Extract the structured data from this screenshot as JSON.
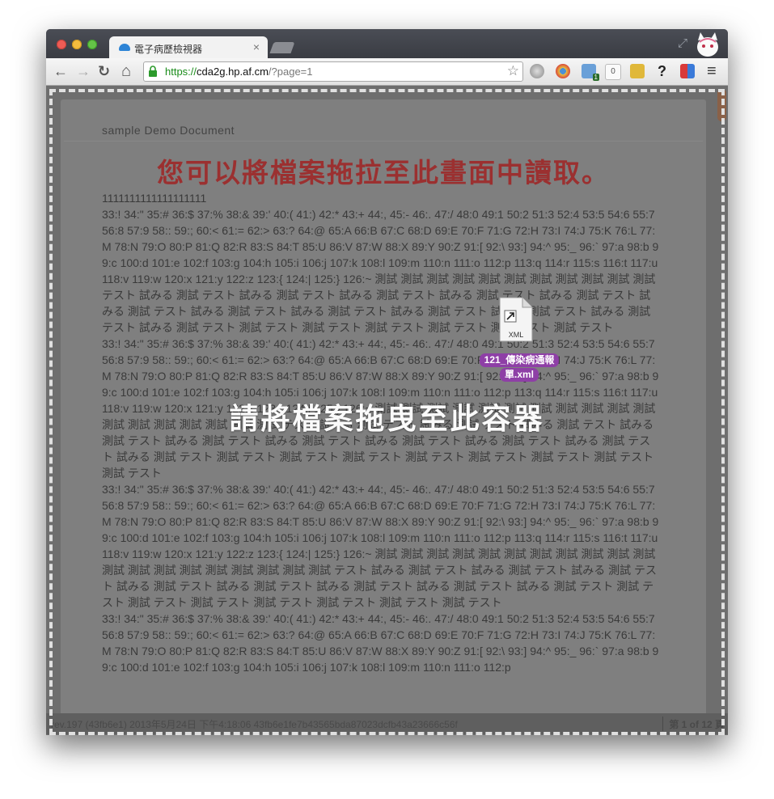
{
  "browser": {
    "tab_title": "電子病歷檢視器",
    "tab_close": "×",
    "url_scheme": "https://",
    "url_host": "cda2g.hp.af.cm",
    "url_path": "/?page=1",
    "back_label": "←",
    "forward_label": "→",
    "reload_label": "↻",
    "home_label": "⌂",
    "star_label": "☆",
    "menu_label": "≡",
    "extensions": [
      {
        "name": "globe-icon",
        "badge": ""
      },
      {
        "name": "chrome-icon",
        "badge": ""
      },
      {
        "name": "puzzle-icon",
        "badge": "1"
      },
      {
        "name": "counter-icon",
        "badge": "0"
      },
      {
        "name": "notes-icon",
        "badge": ""
      },
      {
        "name": "help-icon",
        "badge": "?"
      },
      {
        "name": "presentation-icon",
        "badge": ""
      }
    ]
  },
  "document": {
    "header": "sample Demo Document",
    "title": "您可以將檔案拖拉至此畫面中讀取。",
    "body": "1111111111111111111\n33:! 34:\" 35:# 36:$ 37:% 38:& 39:' 40:( 41:) 42:* 43:+ 44:, 45:- 46:. 47:/ 48:0 49:1 50:2 51:3 52:4 53:5 54:6 55:7 56:8 57:9 58:: 59:; 60:< 61:= 62:> 63:? 64:@ 65:A 66:B 67:C 68:D 69:E 70:F 71:G 72:H 73:I 74:J 75:K 76:L 77:M 78:N 79:O 80:P 81:Q 82:R 83:S 84:T 85:U 86:V 87:W 88:X 89:Y 90:Z 91:[ 92:\\ 93:] 94:^ 95:_ 96:` 97:a 98:b 99:c 100:d 101:e 102:f 103:g 104:h 105:i 106:j 107:k 108:l 109:m 110:n 111:o 112:p 113:q 114:r 115:s 116:t 117:u 118:v 119:w 120:x 121:y 122:z 123:{ 124:| 125:} 126:~ 測試 測試 測試 測試 測試 測試 測試 測試 測試 測試 測試 テスト 試みる 測試 テスト 試みる 測試 テスト 試みる 測試 テスト 試みる 測試 テスト 試みる 測試 テスト 試みる 測試 テスト 試みる 測試 テスト 試みる 測試 テスト 試みる 測試 テスト 試みる 測試 テスト 試みる 測試 テスト 試みる 測試 テスト 測試 テスト 測試 テスト 測試 テスト 測試 テスト 測試 テスト 測試 テスト\n33:! 34:\" 35:# 36:$ 37:% 38:& 39:' 40:( 41:) 42:* 43:+ 44:, 45:- 46:. 47:/ 48:0 49:1 50:2 51:3 52:4 53:5 54:6 55:7 56:8 57:9 58:: 59:; 60:< 61:= 62:> 63:? 64:@ 65:A 66:B 67:C 68:D 69:E 70:F 71:G 72:H 73:I 74:J 75:K 76:L 77:M 78:N 79:O 80:P 81:Q 82:R 83:S 84:T 85:U 86:V 87:W 88:X 89:Y 90:Z 91:[ 92:\\ 93:] 94:^ 95:_ 96:` 97:a 98:b 99:c 100:d 101:e 102:f 103:g 104:h 105:i 106:j 107:k 108:l 109:m 110:n 111:o 112:p 113:q 114:r 115:s 116:t 117:u 118:v 119:w 120:x 121:y 122:z 123:{ 124:| 125:} 126:~ 測試 測試 測試 測試 測試 測試 測試 測試 測試 測試 測試 測試 測試 測試 測試 測試 測試 測試 テスト 試みる 測試 テスト 試みる 測試 テスト 試みる 測試 テスト 試みる 測試 テスト 試みる 測試 テスト 試みる 測試 テスト 試みる 測試 テスト 試みる 測試 テスト 試みる 測試 テスト 試みる 測試 テスト 測試 テスト 測試 テスト 測試 テスト 測試 テスト 測試 テスト 測試 テスト 測試 テスト 測試 テスト\n33:! 34:\" 35:# 36:$ 37:% 38:& 39:' 40:( 41:) 42:* 43:+ 44:, 45:- 46:. 47:/ 48:0 49:1 50:2 51:3 52:4 53:5 54:6 55:7 56:8 57:9 58:: 59:; 60:< 61:= 62:> 63:? 64:@ 65:A 66:B 67:C 68:D 69:E 70:F 71:G 72:H 73:I 74:J 75:K 76:L 77:M 78:N 79:O 80:P 81:Q 82:R 83:S 84:T 85:U 86:V 87:W 88:X 89:Y 90:Z 91:[ 92:\\ 93:] 94:^ 95:_ 96:` 97:a 98:b 99:c 100:d 101:e 102:f 103:g 104:h 105:i 106:j 107:k 108:l 109:m 110:n 111:o 112:p 113:q 114:r 115:s 116:t 117:u 118:v 119:w 120:x 121:y 122:z 123:{ 124:| 125:} 126:~ 測試 測試 測試 測試 測試 測試 測試 測試 測試 測試 測試 測試 測試 測試 測試 測試 測試 測試 測試 測試 テスト 試みる 測試 テスト 試みる 測試 テスト 試みる 測試 テスト 試みる 測試 テスト 試みる 測試 テスト 試みる 測試 テスト 試みる 測試 テスト 試みる 測試 テスト 測試 テスト 測試 テスト 測試 テスト 測試 テスト 測試 テスト 測試 テスト 測試 テスト\n33:! 34:\" 35:# 36:$ 37:% 38:& 39:' 40:( 41:) 42:* 43:+ 44:, 45:- 46:. 47:/ 48:0 49:1 50:2 51:3 52:4 53:5 54:6 55:7 56:8 57:9 58:: 59:; 60:< 61:= 62:> 63:? 64:@ 65:A 66:B 67:C 68:D 69:E 70:F 71:G 72:H 73:I 74:J 75:K 76:L 77:M 78:N 79:O 80:P 81:Q 82:R 83:S 84:T 85:U 86:V 87:W 88:X 89:Y 90:Z 91:[ 92:\\ 93:] 94:^ 95:_ 96:` 97:a 98:b 99:c 100:d 101:e 102:f 103:g 104:h 105:i 106:j 107:k 108:l 109:m 110:n 111:o 112:p"
  },
  "status": {
    "left": "rev.197 (43fb6e1) 2013年5月24日 下午4:18:06 43fb6e1fe7b43565bda87023dcfb43a23666c56f",
    "page": "第 1 of 12 頁"
  },
  "dropzone": {
    "message": "請將檔案拖曳至此容器"
  },
  "drag_file": {
    "type_label": "XML",
    "name_line1": "121_傳染病通報",
    "name_line2": "單.xml"
  },
  "colors": {
    "title_red": "#9b3030",
    "drag_badge": "#8e3fa6",
    "url_green": "#1a8c1a"
  }
}
